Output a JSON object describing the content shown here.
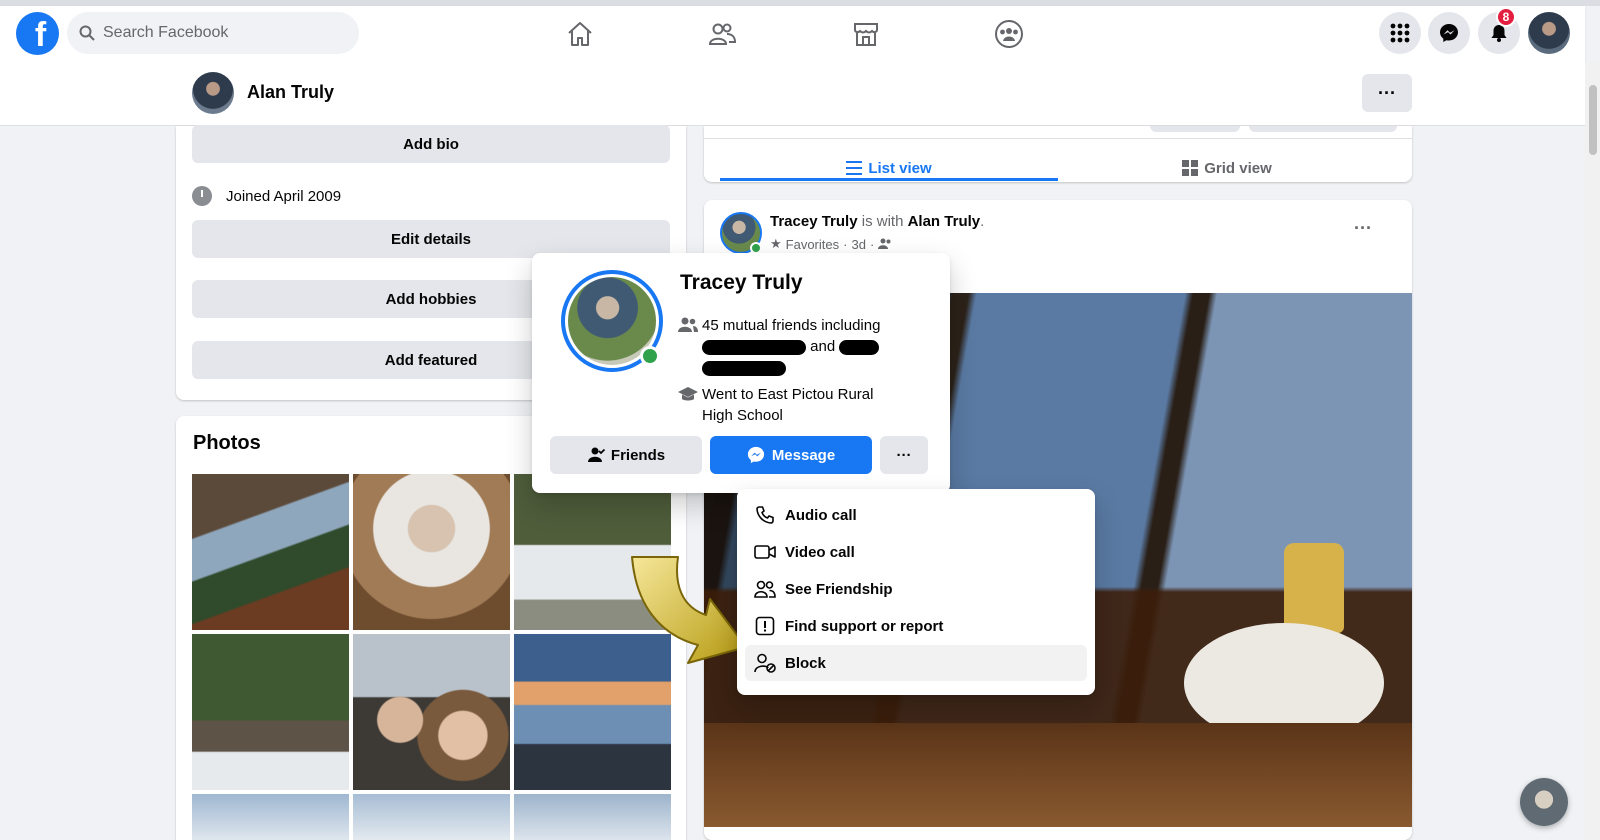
{
  "topbar": {
    "logo_letter": "f",
    "search_placeholder": "Search Facebook",
    "notification_count": "8"
  },
  "profile_bar": {
    "name": "Alan Truly",
    "more_label": "···"
  },
  "intro": {
    "add_bio": "Add bio",
    "joined": "Joined April 2009",
    "edit_details": "Edit details",
    "add_hobbies": "Add hobbies",
    "add_featured": "Add featured"
  },
  "photos": {
    "title": "Photos"
  },
  "feed_tabs": {
    "list_view": "List view",
    "grid_view": "Grid view"
  },
  "post": {
    "author": "Tracey Truly",
    "is_with": "is with",
    "tagged": "Alan Truly",
    "period": ".",
    "audience": "Favorites",
    "time": "3d",
    "more_label": "···"
  },
  "hovercard": {
    "name": "Tracey Truly",
    "mutual": "45 mutual friends including",
    "and": "and",
    "school": "Went to East Pictou Rural High School",
    "friends_button": "Friends",
    "message_button": "Message",
    "more_label": "···"
  },
  "menu": {
    "items": [
      {
        "label": "Audio call",
        "icon": "phone-icon"
      },
      {
        "label": "Video call",
        "icon": "video-icon"
      },
      {
        "label": "See Friendship",
        "icon": "friends-icon"
      },
      {
        "label": "Find support or report",
        "icon": "report-icon"
      },
      {
        "label": "Block",
        "icon": "block-user-icon"
      }
    ]
  },
  "colors": {
    "brand": "#1877f2",
    "button_gray": "#e4e6eb",
    "online": "#31a24c",
    "badge": "#e41e3f",
    "arrow": "#e2c93a"
  }
}
